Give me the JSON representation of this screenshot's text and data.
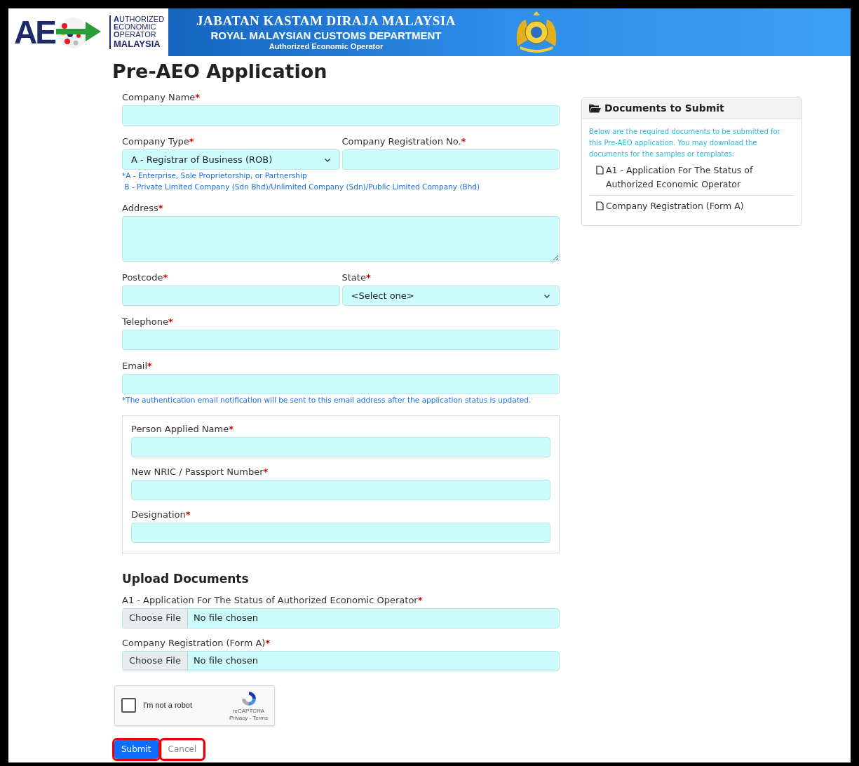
{
  "header": {
    "logo_mark": "AE",
    "logo_lines": [
      {
        "initial": "A",
        "rest": "UTHORIZED"
      },
      {
        "initial": "E",
        "rest": "CONOMIC"
      },
      {
        "initial": "O",
        "rest": "PERATOR"
      }
    ],
    "logo_country": "MALAYSIA",
    "title_malay": "JABATAN KASTAM DIRAJA MALAYSIA",
    "title_english": "ROYAL MALAYSIAN CUSTOMS DEPARTMENT",
    "subtitle": "Authorized Economic Operator"
  },
  "page_title": "Pre-AEO Application",
  "form": {
    "rows": [
      {
        "fields": [
          {
            "label": "Company Name",
            "asterisk": "*",
            "kind": "input"
          }
        ]
      },
      {
        "fields": [
          {
            "label": "Company Type",
            "asterisk": "*",
            "kind": "select",
            "value": "A - Registrar of Business (ROB)"
          },
          {
            "label": "Company Registration No.",
            "asterisk": "*",
            "kind": "input"
          }
        ],
        "notes": [
          "*A - Enterprise, Sole Proprietorship, or Partnership",
          " B - Private Limited Company (Sdn Bhd)/Unlimited Company (Sdn)/Public Limited Company (Bhd)"
        ]
      },
      {
        "fields": [
          {
            "label": "Address",
            "asterisk": "*",
            "kind": "textarea"
          }
        ]
      },
      {
        "fields": [
          {
            "label": "Postcode",
            "asterisk": "*",
            "kind": "input"
          },
          {
            "label": "State",
            "asterisk": "*",
            "kind": "select",
            "value": "<Select one>"
          }
        ]
      },
      {
        "fields": [
          {
            "label": "Telephone",
            "asterisk": "*",
            "kind": "input"
          }
        ]
      },
      {
        "fields": [
          {
            "label": "Email",
            "asterisk": "*",
            "kind": "input"
          }
        ],
        "notes": [
          "*The authentication email notification will be sent to this email address after the application status is updated."
        ]
      }
    ],
    "person_fields": [
      {
        "label": "Person Applied Name",
        "asterisk": "*",
        "kind": "input"
      },
      {
        "label": "New NRIC / Passport Number",
        "asterisk": "*",
        "kind": "input"
      },
      {
        "label": "Designation",
        "asterisk": "*",
        "kind": "input"
      }
    ],
    "upload_heading": "Upload Documents",
    "uploads": [
      {
        "label": "A1 - Application For The Status of Authorized Economic Operator",
        "asterisk": "*",
        "button": "Choose File",
        "status": "No file chosen"
      },
      {
        "label": "Company Registration (Form A)",
        "asterisk": "*",
        "button": "Choose File",
        "status": "No file chosen"
      }
    ],
    "captcha": {
      "checked": false,
      "label": "I'm not a robot",
      "brand": "reCAPTCHA",
      "links": "Privacy - Terms"
    },
    "buttons": [
      {
        "label": "Submit",
        "kind": "primary",
        "highlighted": true
      },
      {
        "label": "Cancel",
        "kind": "secondary",
        "highlighted": true
      }
    ]
  },
  "documents_panel": {
    "title": "Documents to Submit",
    "intro": "Below are the required documents to be submitted for this Pre-AEO application. You may download the documents for the samples or templates:",
    "items": [
      "A1 - Application For The Status of Authorized Economic Operator",
      "Company Registration (Form A)"
    ]
  }
}
